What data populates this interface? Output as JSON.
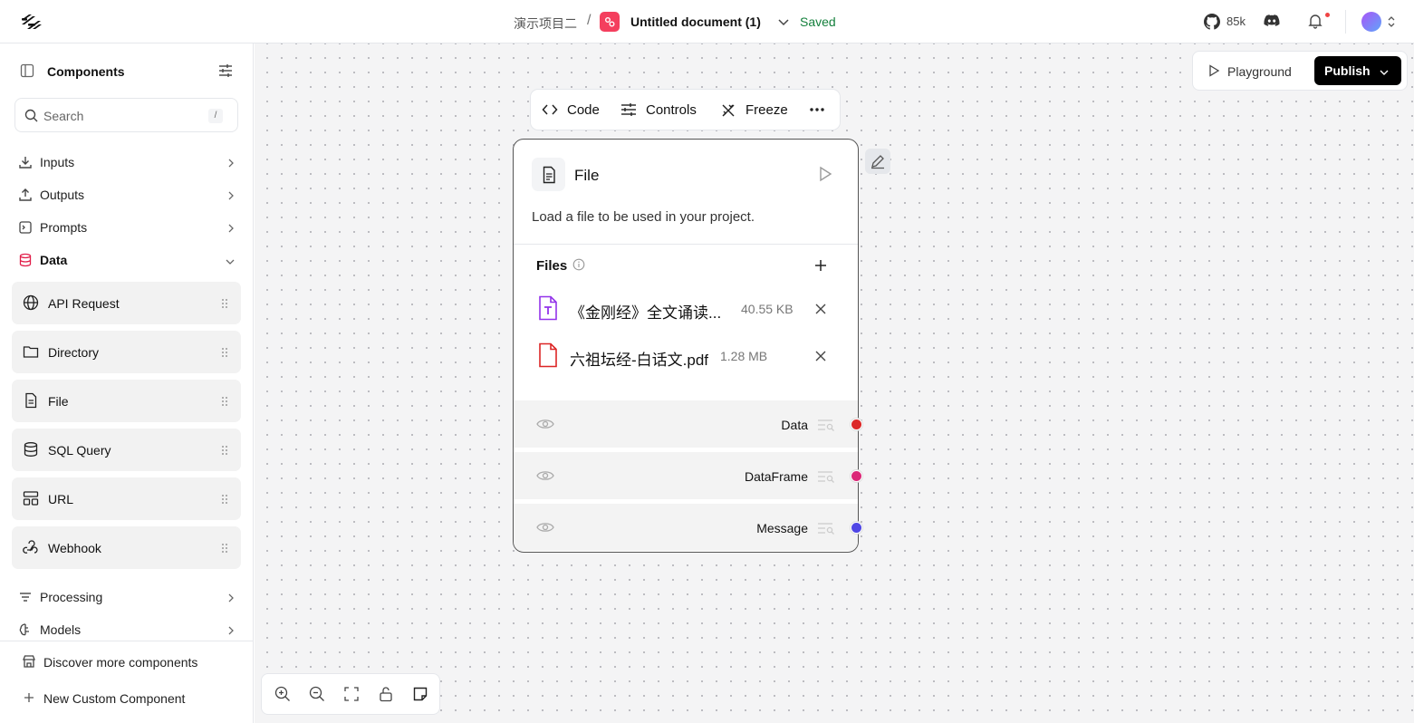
{
  "topbar": {
    "project_name": "演示项目二",
    "separator": "/",
    "document_title": "Untitled document (1)",
    "save_status": "Saved",
    "github_stars": "85k"
  },
  "sidebar": {
    "title": "Components",
    "search": {
      "placeholder": "Search",
      "shortcut": "/"
    },
    "categories_top": [
      {
        "label": "Inputs",
        "icon": "download-icon"
      },
      {
        "label": "Outputs",
        "icon": "upload-icon"
      },
      {
        "label": "Prompts",
        "icon": "prompt-icon"
      },
      {
        "label": "Data",
        "icon": "database-icon",
        "expanded": true
      }
    ],
    "data_components": [
      {
        "label": "API Request",
        "icon": "globe-icon"
      },
      {
        "label": "Directory",
        "icon": "folder-icon"
      },
      {
        "label": "File",
        "icon": "file-icon"
      },
      {
        "label": "SQL Query",
        "icon": "database-icon"
      },
      {
        "label": "URL",
        "icon": "layout-icon"
      },
      {
        "label": "Webhook",
        "icon": "webhook-icon"
      }
    ],
    "categories_bottom": [
      {
        "label": "Processing",
        "icon": "filter-icon"
      },
      {
        "label": "Models",
        "icon": "brain-icon"
      }
    ],
    "footer": {
      "discover": "Discover more components",
      "new_custom": "New Custom Component"
    }
  },
  "canvas": {
    "playground_label": "Playground",
    "publish_label": "Publish",
    "node_toolbar": {
      "code": "Code",
      "controls": "Controls",
      "freeze": "Freeze"
    },
    "node": {
      "title": "File",
      "description": "Load a file to be used in your project.",
      "files_label": "Files",
      "files": [
        {
          "name": "《金刚经》全文诵读...",
          "size": "40.55 KB",
          "type": "txt",
          "color": "#9333ea"
        },
        {
          "name": "六祖坛经-白话文.pdf",
          "size": "1.28 MB",
          "type": "pdf",
          "color": "#dc2626"
        }
      ],
      "outputs": [
        {
          "label": "Data",
          "color": "#dc2626"
        },
        {
          "label": "DataFrame",
          "color": "#db2777"
        },
        {
          "label": "Message",
          "color": "#4f46e5"
        }
      ]
    }
  },
  "colors": {
    "accent": "#f43f5e",
    "saved": "#15803d",
    "data_active": "#e11d48"
  }
}
